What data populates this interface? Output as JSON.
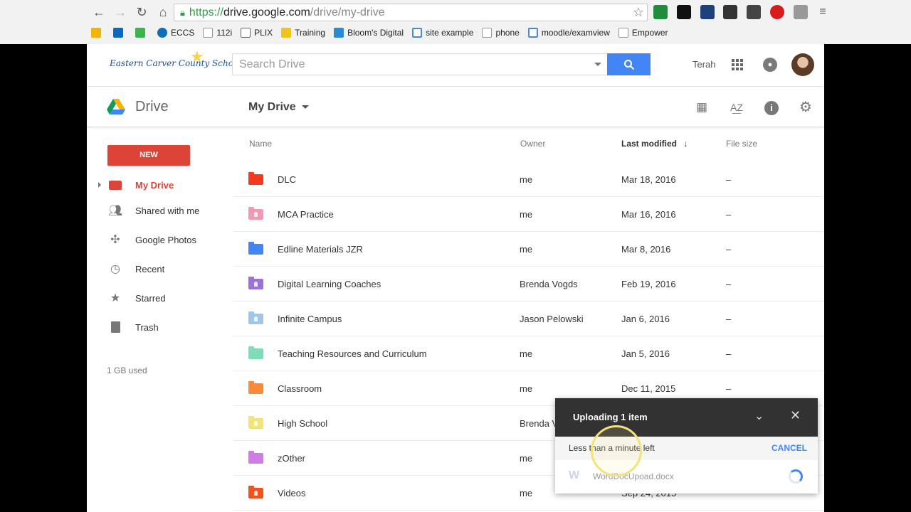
{
  "browser": {
    "url_scheme": "https://",
    "url_domain": "drive.google.com",
    "url_path": "/drive/my-drive",
    "bookmarks": [
      "ECCS",
      "112i",
      "PLIX",
      "Training",
      "Bloom's Digital",
      "site example",
      "phone",
      "moodle/examview",
      "Empower"
    ]
  },
  "header": {
    "logo_text": "Eastern Carver County Schools",
    "search_placeholder": "Search Drive",
    "user_name": "Terah"
  },
  "drivebar": {
    "app_title": "Drive",
    "location": "My Drive"
  },
  "sidebar": {
    "new_label": "NEW",
    "items": [
      {
        "label": "My Drive",
        "icon": "drive-folder-icon"
      },
      {
        "label": "Shared with me",
        "icon": "people-icon"
      },
      {
        "label": "Google Photos",
        "icon": "pinwheel-icon"
      },
      {
        "label": "Recent",
        "icon": "clock-icon"
      },
      {
        "label": "Starred",
        "icon": "star-icon"
      },
      {
        "label": "Trash",
        "icon": "trash-icon"
      }
    ],
    "storage_used": "1 GB used"
  },
  "list": {
    "columns": {
      "name": "Name",
      "owner": "Owner",
      "modified": "Last modified",
      "size": "File size"
    },
    "rows": [
      {
        "name": "DLC",
        "owner": "me",
        "modified": "Mar 18, 2016",
        "size": "–",
        "color": "#f4391f",
        "shared": false
      },
      {
        "name": "MCA Practice",
        "owner": "me",
        "modified": "Mar 16, 2016",
        "size": "–",
        "color": "#f39ab3",
        "shared": true
      },
      {
        "name": "Edline Materials JZR",
        "owner": "me",
        "modified": "Mar 8, 2016",
        "size": "–",
        "color": "#4285f4",
        "shared": false
      },
      {
        "name": "Digital Learning Coaches",
        "owner": "Brenda Vogds",
        "modified": "Feb 19, 2016",
        "size": "–",
        "color": "#9b72d8",
        "shared": true
      },
      {
        "name": "Infinite Campus",
        "owner": "Jason Pelowski",
        "modified": "Jan 6, 2016",
        "size": "–",
        "color": "#9fc7ec",
        "shared": true
      },
      {
        "name": "Teaching Resources and Curriculum",
        "owner": "me",
        "modified": "Jan 5, 2016",
        "size": "–",
        "color": "#7fddb5",
        "shared": false
      },
      {
        "name": "Classroom",
        "owner": "me",
        "modified": "Dec 11, 2015",
        "size": "–",
        "color": "#fb8a38",
        "shared": false
      },
      {
        "name": "High School",
        "owner": "Brenda V",
        "modified": "",
        "size": "",
        "color": "#f6e27a",
        "shared": true
      },
      {
        "name": "zOther",
        "owner": "me",
        "modified": "",
        "size": "",
        "color": "#d07be6",
        "shared": false
      },
      {
        "name": "Videos",
        "owner": "me",
        "modified": "Sep 24, 2015",
        "size": "",
        "color": "#f4511e",
        "shared": true
      }
    ]
  },
  "upload": {
    "title": "Uploading 1 item",
    "status": "Less than a minute left",
    "cancel_label": "CANCEL",
    "file_icon": "W",
    "file_name": "WordDocUpoad.docx"
  }
}
